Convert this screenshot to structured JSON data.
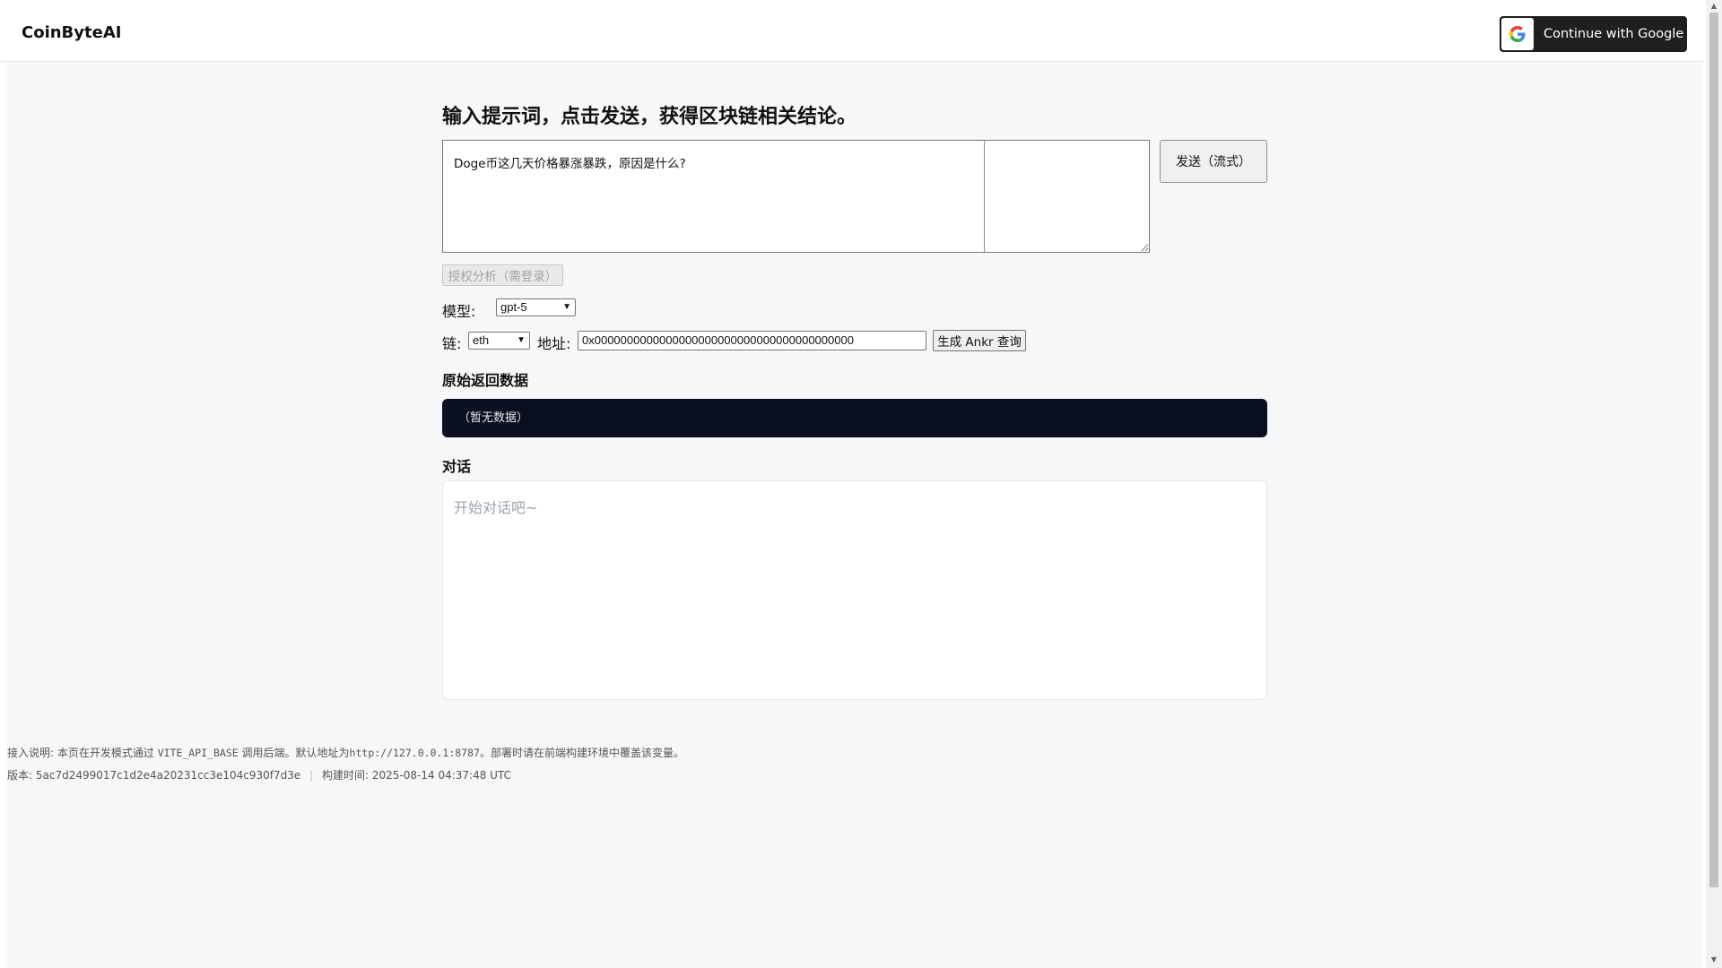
{
  "header": {
    "brand": "CoinByteAI",
    "google_button_label": "Continue with Google"
  },
  "main": {
    "heading": "输入提示词，点击发送，获得区块链相关结论。",
    "prompt_value": "Doge币这几天价格暴涨暴跌，原因是什么?",
    "send_button_label": "发送（流式）",
    "auth_button_label": "授权分析（需登录）",
    "model_label": "模型:",
    "model_value": "gpt-5",
    "chain_label": "链:",
    "chain_value": "eth",
    "address_label": "地址:",
    "address_value": "0x0000000000000000000000000000000000000000",
    "ankr_button_label": "生成 Ankr 查询",
    "raw_title": "原始返回数据",
    "raw_empty": "（暂无数据）",
    "chat_title": "对话",
    "chat_placeholder": "开始对话吧~"
  },
  "footer": {
    "note_prefix": "接入说明: 本页在开发模式通过",
    "note_var": "VITE_API_BASE",
    "note_mid": "调用后端。默认地址为",
    "note_url": "http://127.0.0.1:8787",
    "note_suffix": "。部署时请在前端构建环境中覆盖该变量。",
    "version_label": "版本:",
    "version_value": "5ac7d2499017c1d2e4a20231cc3e104c930f7d3e",
    "build_label": "构建时间:",
    "build_value": "2025-08-14 04:37:48 UTC"
  },
  "colors": {
    "raw_box_bg": "#0b1020",
    "google_button_bg": "#1f1f1f",
    "page_bg": "#f6f7f9"
  },
  "icons": [
    "google-g-icon",
    "chevron-down-icon",
    "scroll-up-arrow-icon",
    "scroll-down-arrow-icon"
  ]
}
